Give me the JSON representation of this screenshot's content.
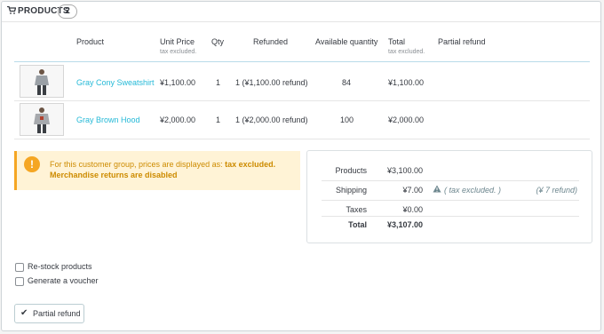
{
  "header": {
    "title": "PRODUCTS",
    "count": "2"
  },
  "columns": {
    "product": "Product",
    "unit_price": "Unit Price",
    "unit_price_note": "tax excluded.",
    "qty": "Qty",
    "refunded": "Refunded",
    "available": "Available quantity",
    "total": "Total",
    "total_note": "tax excluded.",
    "partial_refund": "Partial refund"
  },
  "rows": [
    {
      "name": "Gray Cony Sweatshirt",
      "unit_price": "¥1,100.00",
      "qty": "1",
      "refunded": "1 (¥1,100.00 refund)",
      "available": "84",
      "total": "¥1,100.00"
    },
    {
      "name": "Gray Brown Hood",
      "unit_price": "¥2,000.00",
      "qty": "1",
      "refunded": "1 (¥2,000.00 refund)",
      "available": "100",
      "total": "¥2,000.00"
    }
  ],
  "alert": {
    "line1_prefix": "For this customer group, prices are displayed as:",
    "line1_bold": "tax excluded.",
    "line2": "Merchandise returns are disabled"
  },
  "totals": {
    "products_label": "Products",
    "products_value": "¥3,100.00",
    "shipping_label": "Shipping",
    "shipping_value": "¥7.00",
    "shipping_note": "( tax excluded. )",
    "shipping_refund": "(¥ 7 refund)",
    "taxes_label": "Taxes",
    "taxes_value": "¥0.00",
    "total_label": "Total",
    "total_value": "¥3,107.00"
  },
  "options": {
    "restock": "Re-stock products",
    "voucher": "Generate a voucher"
  },
  "button": {
    "label": "Partial refund"
  },
  "colors": {
    "link": "#25b9d7",
    "warning": "#f5a623",
    "warning_bg": "#fff3d6"
  }
}
